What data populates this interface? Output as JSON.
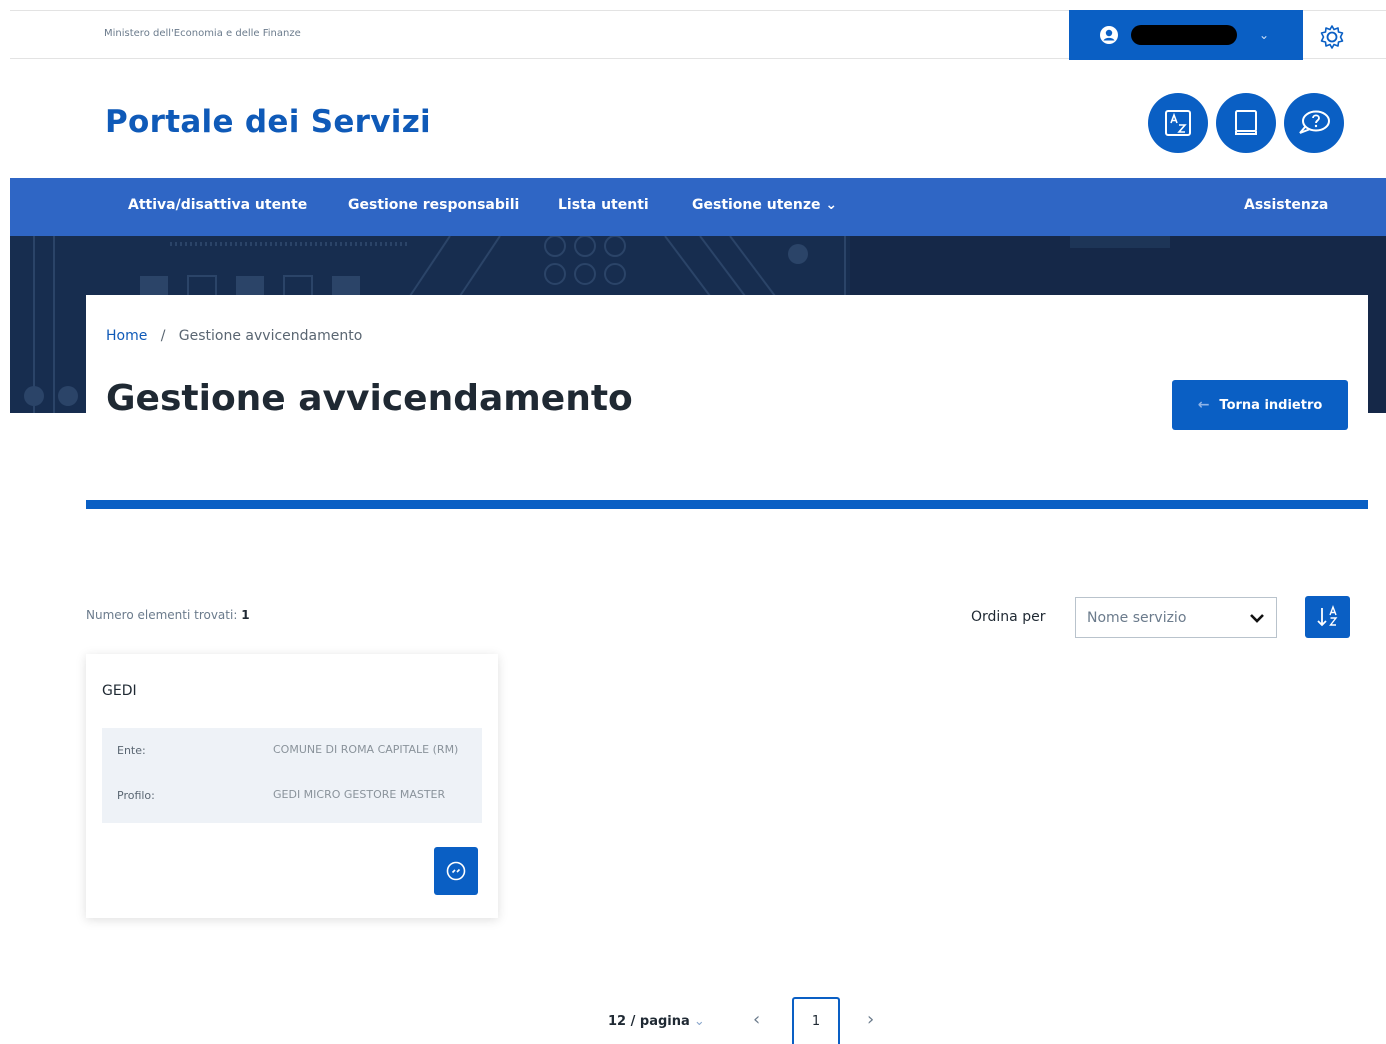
{
  "topbar": {
    "ministry": "Ministero dell'Economia e delle Finanze",
    "user_chevron": "⌄"
  },
  "header": {
    "title": "Portale dei Servizi",
    "icons": [
      "az-glossary-icon",
      "book-icon",
      "help-chat-icon"
    ]
  },
  "nav": {
    "items": [
      {
        "label": "Attiva/disattiva utente"
      },
      {
        "label": "Gestione responsabili"
      },
      {
        "label": "Lista utenti"
      },
      {
        "label": "Gestione utenze ⌄"
      }
    ],
    "assistance": "Assistenza"
  },
  "breadcrumb": {
    "home": "Home",
    "separator": "/",
    "current": "Gestione avvicendamento"
  },
  "page_title": "Gestione avvicendamento",
  "back_button": {
    "arrow": "←",
    "label": "Torna indietro"
  },
  "results": {
    "count_label": "Numero elementi trovati:",
    "count_value": "1",
    "sort_label": "Ordina per",
    "sort_selected": "Nome servizio"
  },
  "card": {
    "title": "GEDI",
    "ente_label": "Ente:",
    "ente_value": "COMUNE DI ROMA CAPITALE (RM)",
    "profilo_label": "Profilo:",
    "profilo_value": "GEDI MICRO GESTORE MASTER"
  },
  "pagination": {
    "page_size": "12 / pagina",
    "page_size_chevron": "⌄",
    "prev": "‹",
    "current": "1",
    "next": "›"
  },
  "colors": {
    "primary": "#0a5fc4",
    "nav": "#2f66c5",
    "hero": "#172d4f"
  }
}
